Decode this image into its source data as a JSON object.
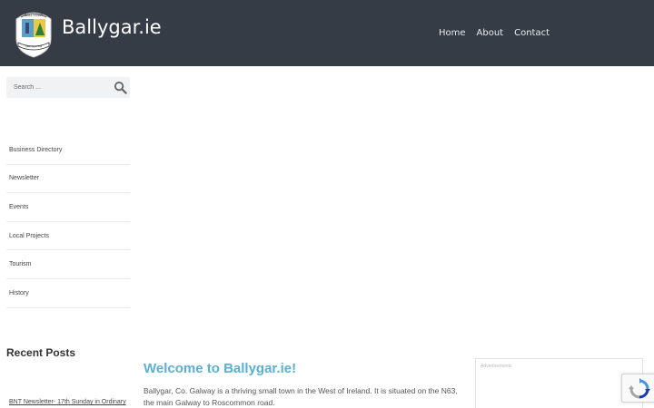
{
  "header": {
    "site_title": "Ballygar.ie",
    "logo": {
      "top_text": "BALLYGAR",
      "banner_text": "Ceart Agus Cóir"
    },
    "nav": [
      {
        "label": "Home"
      },
      {
        "label": "About"
      },
      {
        "label": "Contact"
      }
    ],
    "background_color": "#353c46"
  },
  "sidebar": {
    "search": {
      "placeholder": "Search ...",
      "icon": "search-icon"
    },
    "menu": [
      {
        "label": "Business Directory"
      },
      {
        "label": "Newsletter"
      },
      {
        "label": "Events"
      },
      {
        "label": "Local Projects"
      },
      {
        "label": "Tourism"
      },
      {
        "label": "History"
      }
    ],
    "recent_posts": {
      "title": "Recent Posts",
      "items": [
        {
          "label": "BNT Newsletter- 17th Sunday in Ordinary"
        }
      ]
    }
  },
  "main": {
    "heading": "Welcome to Ballygar.ie!",
    "intro": "Ballygar, Co. Galway is a thriving small town in the West of Ireland. It is situated on the N63, the main Galway to Roscommon road.",
    "accent_color": "#5bafd0"
  },
  "ad": {
    "label": "Advertisements"
  },
  "recaptcha": {
    "icon": "recaptcha-icon"
  }
}
